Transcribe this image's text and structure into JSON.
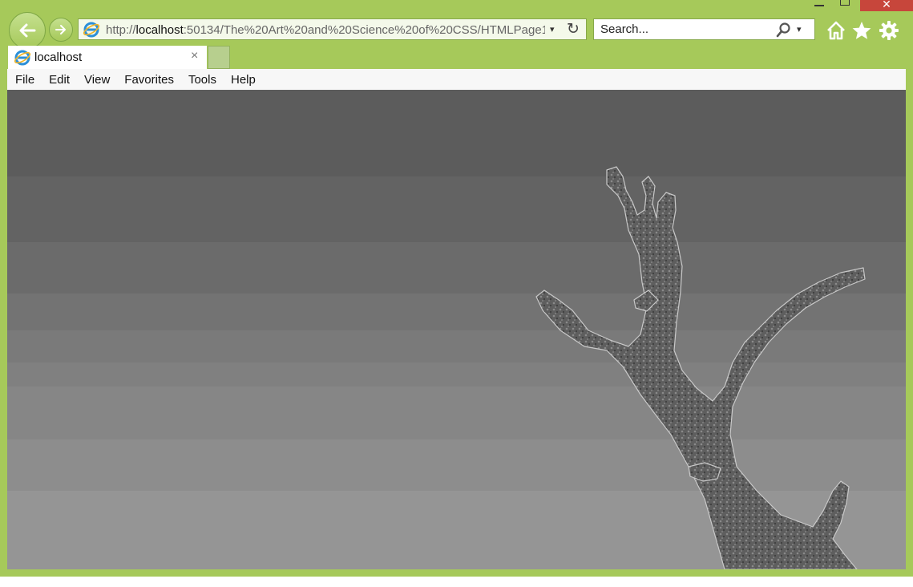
{
  "window": {
    "close_glyph": "✕"
  },
  "toolbar": {
    "address_prefix": "http://",
    "address_host": "localhost",
    "address_rest": ":50134/The%20Art%20and%20Science%20of%20CSS/HTMLPage1.h",
    "address_dropdown_glyph": "▾",
    "refresh_glyph": "↻",
    "search_placeholder": "Search...",
    "search_dropdown_glyph": "▾",
    "icons": [
      "back-arrow-icon",
      "forward-arrow-icon",
      "ie-logo-icon",
      "refresh-icon",
      "search-icon",
      "home-icon",
      "favorites-star-icon",
      "settings-gear-icon"
    ]
  },
  "tabs": [
    {
      "title": "localhost",
      "close_glyph": "×",
      "active": true
    }
  ],
  "menubar": {
    "items": [
      "File",
      "Edit",
      "View",
      "Favorites",
      "Tools",
      "Help"
    ]
  },
  "colors": {
    "frame": "#a6c95a",
    "close_button": "#c7463b",
    "content_top": "#5c5c5c",
    "content_bottom": "#959595"
  },
  "content": {
    "description_icon": "dead-tree-branch-image"
  }
}
